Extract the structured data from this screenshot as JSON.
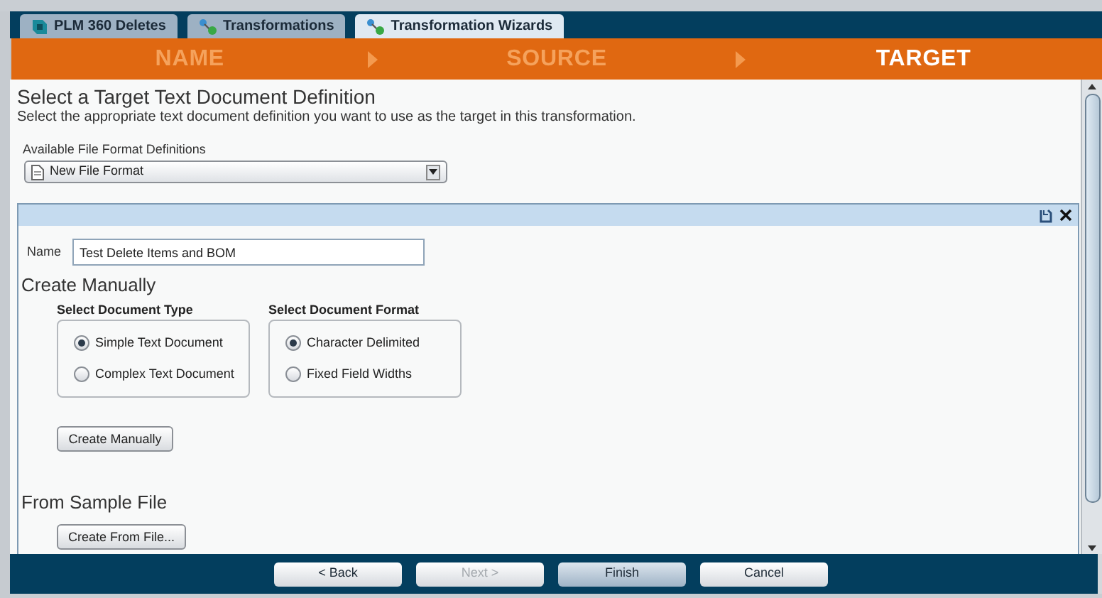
{
  "tabs": [
    {
      "label": "PLM 360 Deletes",
      "kind": "plm",
      "selected": false
    },
    {
      "label": "Transformations",
      "kind": "transform",
      "selected": false
    },
    {
      "label": "Transformation Wizards",
      "kind": "transform",
      "selected": true
    }
  ],
  "steps": [
    {
      "label": "NAME",
      "selected": false
    },
    {
      "label": "SOURCE",
      "selected": false
    },
    {
      "label": "TARGET",
      "selected": true
    }
  ],
  "heading": "Select a Target Text Document Definition",
  "description": "Select the appropriate text document definition you want to use as the target in this transformation.",
  "format_select": {
    "label": "Available File Format Definitions",
    "value": "New File Format"
  },
  "panel": {
    "name_label": "Name",
    "name_value": "Test Delete Items and BOM",
    "manual_title": "Create Manually",
    "groups": [
      {
        "title": "Select Document Type",
        "options": [
          {
            "label": "Simple Text Document",
            "selected": true
          },
          {
            "label": "Complex Text Document",
            "selected": false
          }
        ]
      },
      {
        "title": "Select Document Format",
        "options": [
          {
            "label": "Character Delimited",
            "selected": true
          },
          {
            "label": "Fixed Field Widths",
            "selected": false
          }
        ]
      }
    ],
    "manual_button": "Create Manually",
    "sample_title": "From Sample File",
    "sample_button": "Create From File..."
  },
  "footer_buttons": [
    {
      "label": "< Back",
      "disabled": false,
      "primary": false
    },
    {
      "label": "Next >",
      "disabled": true,
      "primary": false
    },
    {
      "label": "Finish",
      "disabled": false,
      "primary": true
    },
    {
      "label": "Cancel",
      "disabled": false,
      "primary": false
    }
  ]
}
